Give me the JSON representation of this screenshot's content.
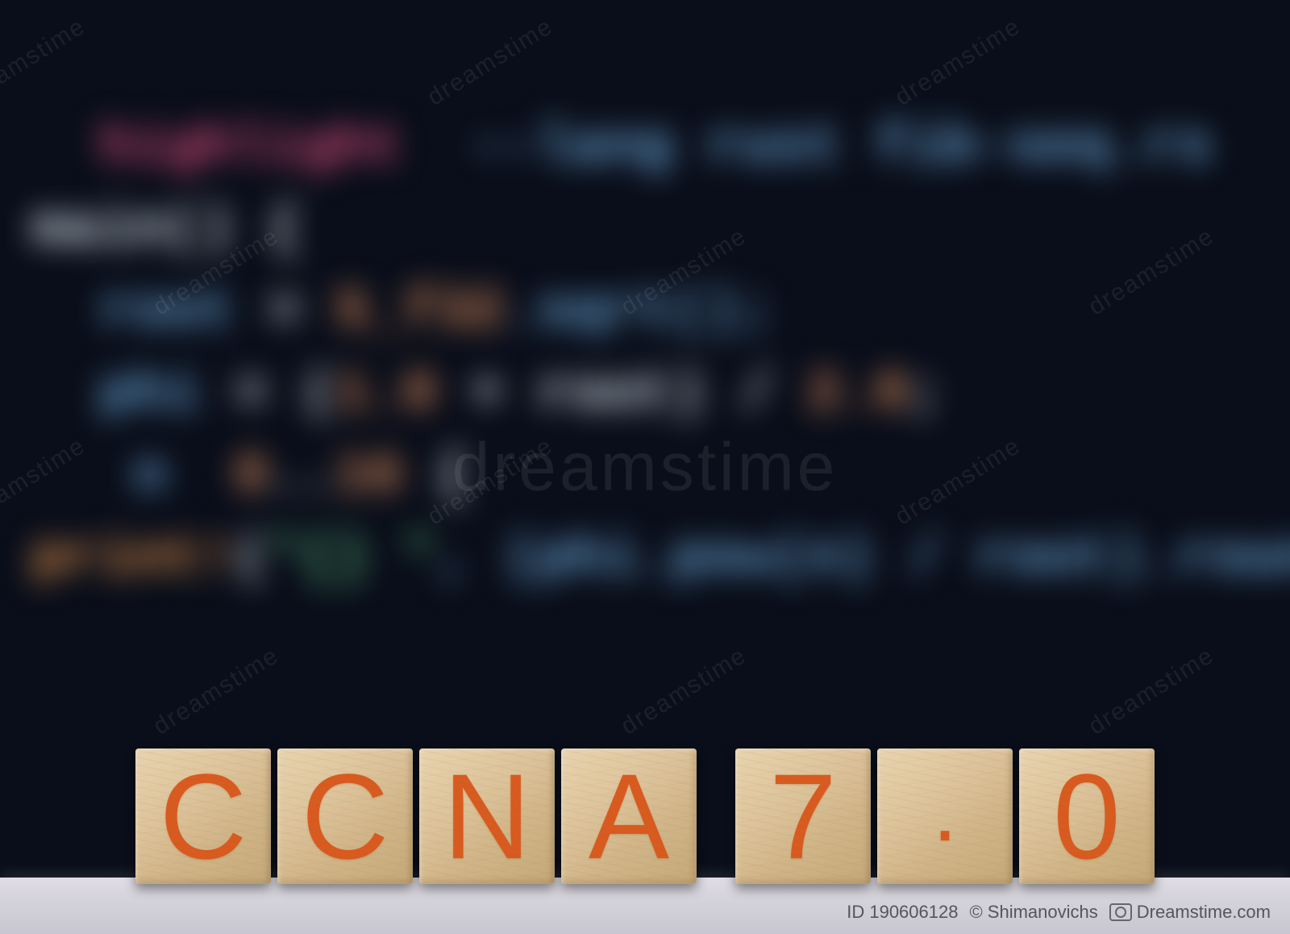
{
  "background_code": {
    "line1_a": "highlight",
    "line1_b": "--lang rust fib-seq.rs",
    "line2": "main() {",
    "line3_a": "root",
    "line3_b": " = ",
    "line3_c": "5_f32",
    "line3_d": ".sqrt();",
    "line4_a": "phi",
    "line4_b": " = (",
    "line4_c": "1.0",
    "line4_d": " + root) / ",
    "line4_e": "2.0",
    "line4_f": ";",
    "line5_a": "n",
    "line5_b": "  ",
    "line5_c": "0",
    "line5_d": "..",
    "line5_e": "16",
    "line5_f": " {",
    "line6_a": "print!",
    "line6_b": "(",
    "line6_c": "\"{} \"",
    "line6_d": ", (phi.pow(n) / root).round()"
  },
  "blocks": {
    "word": [
      "C",
      "C",
      "N",
      "A"
    ],
    "version": [
      "7",
      ".",
      "0"
    ]
  },
  "watermark": {
    "repeat_text": "dreamstime",
    "center_text": "dreamstime"
  },
  "attribution": {
    "id_label": "ID 190606128",
    "copyright": "© Shimanovichs",
    "brand": "Dreamstime.com"
  }
}
